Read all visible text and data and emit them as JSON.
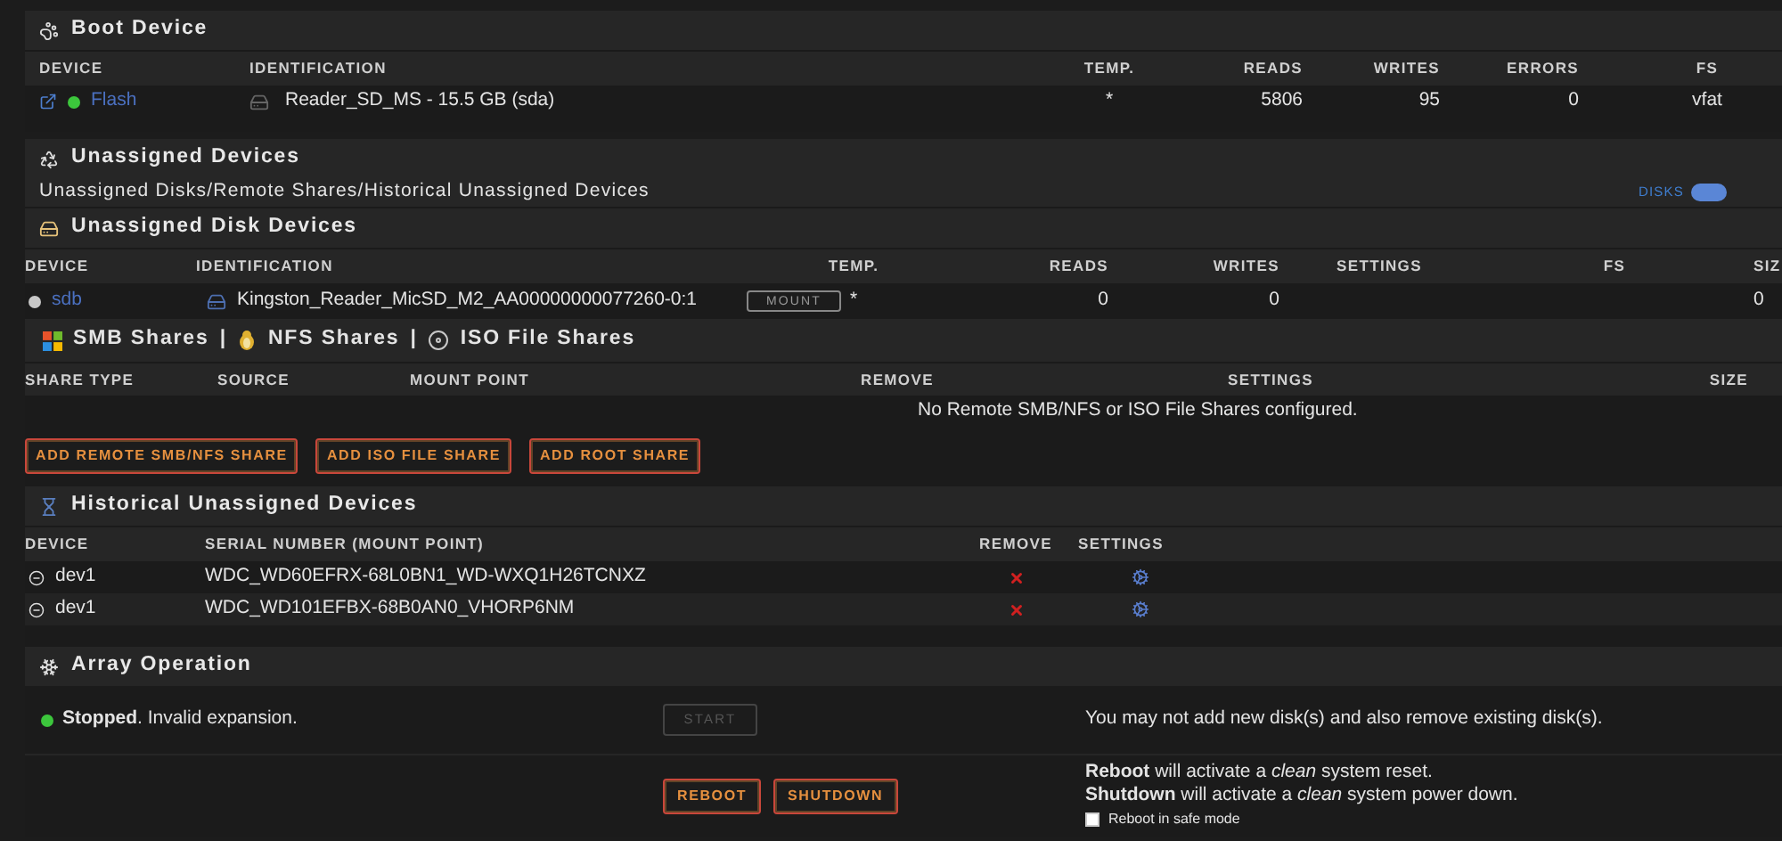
{
  "boot_device": {
    "title": "Boot Device",
    "columns": [
      "DEVICE",
      "IDENTIFICATION",
      "TEMP.",
      "READS",
      "WRITES",
      "ERRORS",
      "FS"
    ],
    "rows": [
      {
        "device": "Flash",
        "color": "#3cc63c",
        "identification": "Reader_SD_MS - 15.5 GB (sda)",
        "temp": "*",
        "reads": "5806",
        "writes": "95",
        "errors": "0",
        "fs": "vfat"
      }
    ]
  },
  "unassigned_devices": {
    "title": "Unassigned Devices",
    "subtitle": "Unassigned Disks/Remote Shares/Historical Unassigned Devices",
    "toggle": {
      "label": "DISKS",
      "on": true
    }
  },
  "unassigned_disk_devices": {
    "title": "Unassigned Disk Devices",
    "columns": [
      "DEVICE",
      "IDENTIFICATION",
      "TEMP.",
      "READS",
      "WRITES",
      "SETTINGS",
      "FS",
      "SIZ"
    ],
    "rows": [
      {
        "device": "sdb",
        "color": "#c8c8c8",
        "identification": "Kingston_Reader_MicSD_M2_AA00000000077260-0:1",
        "button": "MOUNT",
        "temp": "*",
        "reads": "0",
        "writes": "0",
        "size": "0"
      }
    ]
  },
  "shares": {
    "title_parts": [
      {
        "kind": "windows",
        "label": "SMB Shares"
      },
      {
        "kind": "separator",
        "label": "|"
      },
      {
        "kind": "linux",
        "label": "NFS Shares"
      },
      {
        "kind": "separator",
        "label": "|"
      },
      {
        "kind": "disc",
        "label": "ISO File Shares"
      }
    ],
    "columns": [
      "SHARE TYPE",
      "SOURCE",
      "MOUNT POINT",
      "REMOVE",
      "SETTINGS",
      "SIZE"
    ],
    "empty_message": "No Remote SMB/NFS or ISO File Shares configured.",
    "buttons": [
      "ADD REMOTE SMB/NFS SHARE",
      "ADD ISO FILE SHARE",
      "ADD ROOT SHARE"
    ]
  },
  "historical": {
    "title": "Historical Unassigned Devices",
    "columns": [
      "DEVICE",
      "SERIAL NUMBER (MOUNT POINT)",
      "REMOVE",
      "SETTINGS"
    ],
    "rows": [
      {
        "device": "dev1",
        "serial": "WDC_WD60EFRX-68L0BN1_WD-WXQ1H26TCNXZ"
      },
      {
        "device": "dev1",
        "serial": "WDC_WD101EFBX-68B0AN0_VHORP6NM"
      }
    ]
  },
  "array_operation": {
    "title": "Array Operation",
    "status": {
      "color": "#3cc63c",
      "text": "**Stopped**. Invalid expansion."
    },
    "start_button": {
      "label": "START",
      "disabled": true
    },
    "start_message": "You may not add new disk(s) and also remove existing disk(s).",
    "power_buttons": [
      "REBOOT",
      "SHUTDOWN"
    ],
    "power_notes": [
      "**Reboot** will activate a *clean* system reset.",
      "**Shutdown** will activate a *clean* system power down."
    ],
    "safe_mode": {
      "label": "Reboot in safe mode",
      "checked": false
    }
  }
}
